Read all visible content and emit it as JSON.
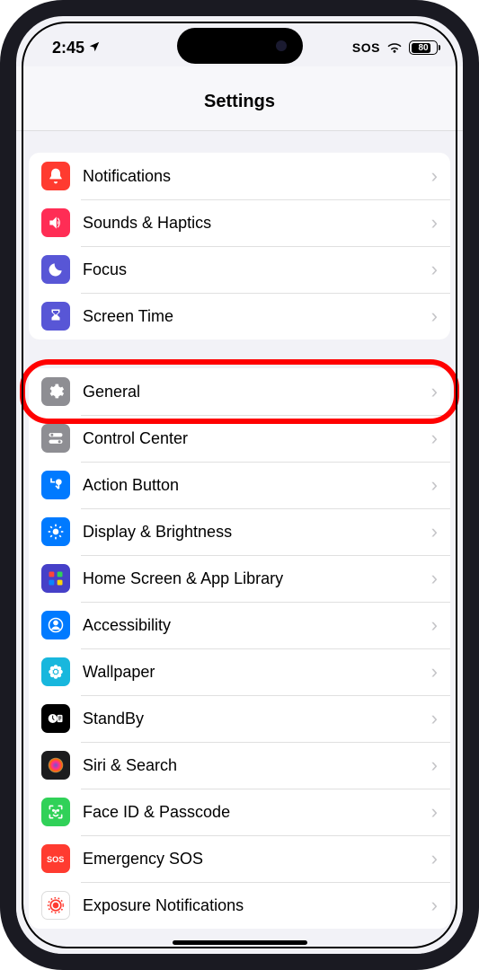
{
  "status": {
    "time": "2:45",
    "sos": "SOS",
    "battery": "80"
  },
  "header": {
    "title": "Settings"
  },
  "groups": [
    {
      "items": [
        {
          "id": "notifications",
          "label": "Notifications",
          "icon": "bell",
          "color": "#ff3b30"
        },
        {
          "id": "sounds",
          "label": "Sounds & Haptics",
          "icon": "speaker",
          "color": "#ff2d55"
        },
        {
          "id": "focus",
          "label": "Focus",
          "icon": "moon",
          "color": "#5856d6"
        },
        {
          "id": "screentime",
          "label": "Screen Time",
          "icon": "hourglass",
          "color": "#5856d6"
        }
      ]
    },
    {
      "items": [
        {
          "id": "general",
          "label": "General",
          "icon": "gear",
          "color": "#8e8e93",
          "highlighted": true
        },
        {
          "id": "controlcenter",
          "label": "Control Center",
          "icon": "switches",
          "color": "#8e8e93"
        },
        {
          "id": "actionbutton",
          "label": "Action Button",
          "icon": "action",
          "color": "#007aff"
        },
        {
          "id": "display",
          "label": "Display & Brightness",
          "icon": "sun",
          "color": "#007aff"
        },
        {
          "id": "homescreen",
          "label": "Home Screen & App Library",
          "icon": "grid",
          "color": "#4640c8"
        },
        {
          "id": "accessibility",
          "label": "Accessibility",
          "icon": "person",
          "color": "#007aff"
        },
        {
          "id": "wallpaper",
          "label": "Wallpaper",
          "icon": "flower",
          "color": "#18b7dd"
        },
        {
          "id": "standby",
          "label": "StandBy",
          "icon": "clock-card",
          "color": "#000000"
        },
        {
          "id": "siri",
          "label": "Siri & Search",
          "icon": "siri",
          "color": "#1c1c1e"
        },
        {
          "id": "faceid",
          "label": "Face ID & Passcode",
          "icon": "face",
          "color": "#30d158"
        },
        {
          "id": "sos-row",
          "label": "Emergency SOS",
          "icon": "sos",
          "color": "#ff3b30"
        },
        {
          "id": "exposure",
          "label": "Exposure Notifications",
          "icon": "exposure",
          "color": "#ffffff"
        }
      ]
    }
  ]
}
